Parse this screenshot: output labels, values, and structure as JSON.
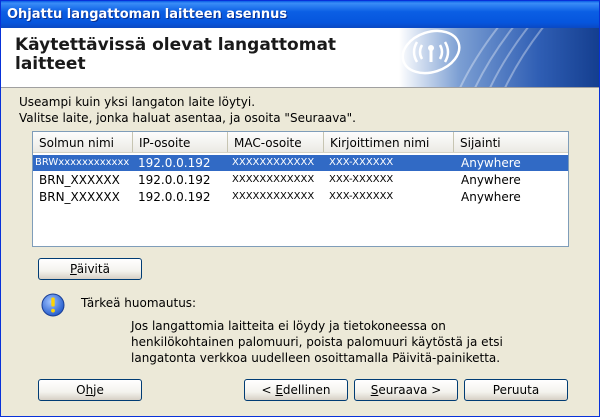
{
  "window": {
    "title": "Ohjattu langattoman laitteen asennus"
  },
  "header": {
    "title": "Käytettävissä olevat langattomat laitteet"
  },
  "intro": {
    "line1": "Useampi kuin yksi langaton laite löytyi.",
    "line2": "Valitse laite, jonka haluat asentaa, ja osoita \"Seuraava\"."
  },
  "table": {
    "columns": [
      "Solmun nimi",
      "IP-osoite",
      "MAC-osoite",
      "Kirjoittimen nimi",
      "Sijainti"
    ],
    "rows": [
      [
        "BRWxxxxxxxxxxxx",
        "192.0.0.192",
        "XXXXXXXXXXXX",
        "XXX-XXXXXX",
        "Anywhere"
      ],
      [
        "BRN_XXXXXX",
        "192.0.0.192",
        "XXXXXXXXXXXX",
        "XXX-XXXXXX",
        "Anywhere"
      ],
      [
        "BRN_XXXXXX",
        "192.0.0.192",
        "XXXXXXXXXXXX",
        "XXX-XXXXXX",
        "Anywhere"
      ]
    ],
    "selected_row": 0
  },
  "refresh_button": {
    "first": "P",
    "rest": "äivitä"
  },
  "notice": {
    "title": "Tärkeä huomautus:",
    "line1": "Jos langattomia laitteita ei löydy ja tietokoneessa on",
    "line2": "henkilökohtainen palomuuri, poista palomuuri käytöstä ja etsi",
    "line3": "langatonta verkkoa uudelleen osoittamalla Päivitä-painiketta."
  },
  "buttons": {
    "help": {
      "pre": "O",
      "mn": "h",
      "post": "je"
    },
    "back": {
      "pre": "< ",
      "mn": "E",
      "post": "dellinen"
    },
    "next": {
      "pre": "",
      "mn": "S",
      "post": "euraava >"
    },
    "cancel": {
      "label": "Peruuta"
    }
  },
  "colors": {
    "titlebar": "#0655dd",
    "selection": "#316ac5",
    "dialog_bg": "#ece9d8"
  },
  "icons": {
    "wifi_logo": "wireless-logo-icon",
    "notice": "info-icon"
  }
}
